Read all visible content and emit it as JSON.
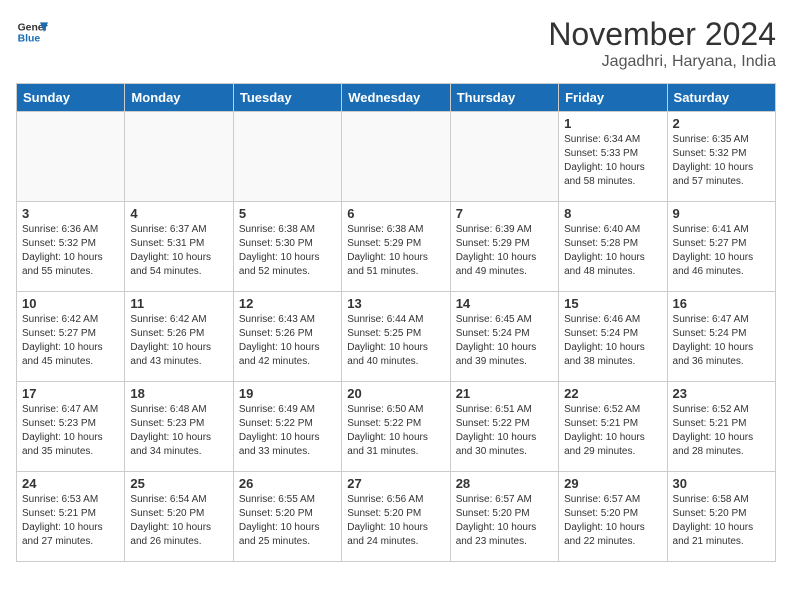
{
  "header": {
    "logo_line1": "General",
    "logo_line2": "Blue",
    "month": "November 2024",
    "location": "Jagadhri, Haryana, India"
  },
  "weekdays": [
    "Sunday",
    "Monday",
    "Tuesday",
    "Wednesday",
    "Thursday",
    "Friday",
    "Saturday"
  ],
  "weeks": [
    [
      {
        "day": "",
        "info": ""
      },
      {
        "day": "",
        "info": ""
      },
      {
        "day": "",
        "info": ""
      },
      {
        "day": "",
        "info": ""
      },
      {
        "day": "",
        "info": ""
      },
      {
        "day": "1",
        "info": "Sunrise: 6:34 AM\nSunset: 5:33 PM\nDaylight: 10 hours\nand 58 minutes."
      },
      {
        "day": "2",
        "info": "Sunrise: 6:35 AM\nSunset: 5:32 PM\nDaylight: 10 hours\nand 57 minutes."
      }
    ],
    [
      {
        "day": "3",
        "info": "Sunrise: 6:36 AM\nSunset: 5:32 PM\nDaylight: 10 hours\nand 55 minutes."
      },
      {
        "day": "4",
        "info": "Sunrise: 6:37 AM\nSunset: 5:31 PM\nDaylight: 10 hours\nand 54 minutes."
      },
      {
        "day": "5",
        "info": "Sunrise: 6:38 AM\nSunset: 5:30 PM\nDaylight: 10 hours\nand 52 minutes."
      },
      {
        "day": "6",
        "info": "Sunrise: 6:38 AM\nSunset: 5:29 PM\nDaylight: 10 hours\nand 51 minutes."
      },
      {
        "day": "7",
        "info": "Sunrise: 6:39 AM\nSunset: 5:29 PM\nDaylight: 10 hours\nand 49 minutes."
      },
      {
        "day": "8",
        "info": "Sunrise: 6:40 AM\nSunset: 5:28 PM\nDaylight: 10 hours\nand 48 minutes."
      },
      {
        "day": "9",
        "info": "Sunrise: 6:41 AM\nSunset: 5:27 PM\nDaylight: 10 hours\nand 46 minutes."
      }
    ],
    [
      {
        "day": "10",
        "info": "Sunrise: 6:42 AM\nSunset: 5:27 PM\nDaylight: 10 hours\nand 45 minutes."
      },
      {
        "day": "11",
        "info": "Sunrise: 6:42 AM\nSunset: 5:26 PM\nDaylight: 10 hours\nand 43 minutes."
      },
      {
        "day": "12",
        "info": "Sunrise: 6:43 AM\nSunset: 5:26 PM\nDaylight: 10 hours\nand 42 minutes."
      },
      {
        "day": "13",
        "info": "Sunrise: 6:44 AM\nSunset: 5:25 PM\nDaylight: 10 hours\nand 40 minutes."
      },
      {
        "day": "14",
        "info": "Sunrise: 6:45 AM\nSunset: 5:24 PM\nDaylight: 10 hours\nand 39 minutes."
      },
      {
        "day": "15",
        "info": "Sunrise: 6:46 AM\nSunset: 5:24 PM\nDaylight: 10 hours\nand 38 minutes."
      },
      {
        "day": "16",
        "info": "Sunrise: 6:47 AM\nSunset: 5:24 PM\nDaylight: 10 hours\nand 36 minutes."
      }
    ],
    [
      {
        "day": "17",
        "info": "Sunrise: 6:47 AM\nSunset: 5:23 PM\nDaylight: 10 hours\nand 35 minutes."
      },
      {
        "day": "18",
        "info": "Sunrise: 6:48 AM\nSunset: 5:23 PM\nDaylight: 10 hours\nand 34 minutes."
      },
      {
        "day": "19",
        "info": "Sunrise: 6:49 AM\nSunset: 5:22 PM\nDaylight: 10 hours\nand 33 minutes."
      },
      {
        "day": "20",
        "info": "Sunrise: 6:50 AM\nSunset: 5:22 PM\nDaylight: 10 hours\nand 31 minutes."
      },
      {
        "day": "21",
        "info": "Sunrise: 6:51 AM\nSunset: 5:22 PM\nDaylight: 10 hours\nand 30 minutes."
      },
      {
        "day": "22",
        "info": "Sunrise: 6:52 AM\nSunset: 5:21 PM\nDaylight: 10 hours\nand 29 minutes."
      },
      {
        "day": "23",
        "info": "Sunrise: 6:52 AM\nSunset: 5:21 PM\nDaylight: 10 hours\nand 28 minutes."
      }
    ],
    [
      {
        "day": "24",
        "info": "Sunrise: 6:53 AM\nSunset: 5:21 PM\nDaylight: 10 hours\nand 27 minutes."
      },
      {
        "day": "25",
        "info": "Sunrise: 6:54 AM\nSunset: 5:20 PM\nDaylight: 10 hours\nand 26 minutes."
      },
      {
        "day": "26",
        "info": "Sunrise: 6:55 AM\nSunset: 5:20 PM\nDaylight: 10 hours\nand 25 minutes."
      },
      {
        "day": "27",
        "info": "Sunrise: 6:56 AM\nSunset: 5:20 PM\nDaylight: 10 hours\nand 24 minutes."
      },
      {
        "day": "28",
        "info": "Sunrise: 6:57 AM\nSunset: 5:20 PM\nDaylight: 10 hours\nand 23 minutes."
      },
      {
        "day": "29",
        "info": "Sunrise: 6:57 AM\nSunset: 5:20 PM\nDaylight: 10 hours\nand 22 minutes."
      },
      {
        "day": "30",
        "info": "Sunrise: 6:58 AM\nSunset: 5:20 PM\nDaylight: 10 hours\nand 21 minutes."
      }
    ]
  ]
}
